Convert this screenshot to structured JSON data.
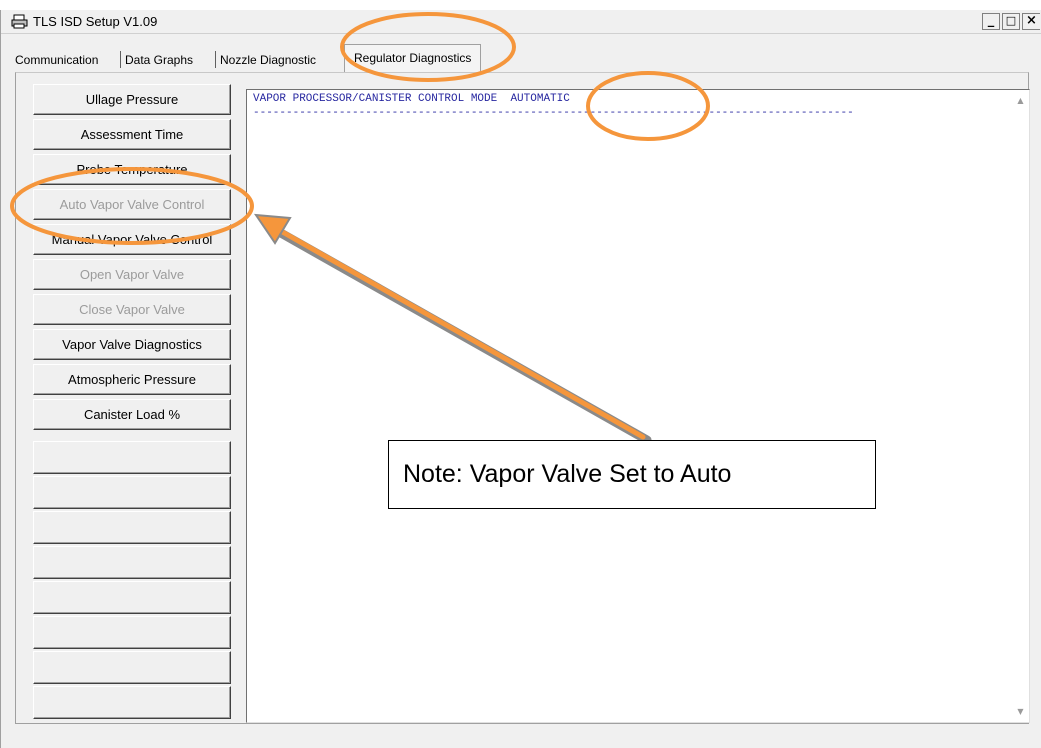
{
  "window": {
    "title": "TLS ISD Setup V1.09",
    "buttons": {
      "minimize": "_",
      "maximize": "□",
      "close": "×"
    }
  },
  "tabs": [
    {
      "label": "Communication",
      "active": false
    },
    {
      "label": "Data Graphs",
      "active": false
    },
    {
      "label": "Nozzle Diagnostic",
      "active": false
    },
    {
      "label": "Regulator Diagnostics",
      "active": true
    }
  ],
  "left_buttons": [
    {
      "label": "Ullage Pressure",
      "enabled": true
    },
    {
      "label": "Assessment Time",
      "enabled": true
    },
    {
      "label": "Probe Temperature",
      "enabled": true
    },
    {
      "label": "Auto Vapor Valve Control",
      "enabled": false
    },
    {
      "label": "Manual Vapor Valve Control",
      "enabled": true
    },
    {
      "label": "Open Vapor Valve",
      "enabled": false
    },
    {
      "label": "Close Vapor Valve",
      "enabled": false
    },
    {
      "label": "Vapor Valve Diagnostics",
      "enabled": true
    },
    {
      "label": "Atmospheric Pressure",
      "enabled": true
    },
    {
      "label": "Canister Load %",
      "enabled": true
    },
    {
      "label": "",
      "enabled": true
    },
    {
      "label": "",
      "enabled": true
    },
    {
      "label": "",
      "enabled": true
    },
    {
      "label": "",
      "enabled": true
    },
    {
      "label": "",
      "enabled": true
    },
    {
      "label": "",
      "enabled": true
    },
    {
      "label": "",
      "enabled": true
    },
    {
      "label": "",
      "enabled": true
    }
  ],
  "output": {
    "mode_label": "VAPOR PROCESSOR/CANISTER CONTROL MODE",
    "mode_value": "AUTOMATIC",
    "separator": "-------------------------------------------------------------------------------------------"
  },
  "annotation": {
    "note": "Note: Vapor Valve Set to Auto",
    "highlight_color": "#f5963c",
    "arrow_color": "#f5963c"
  },
  "colors": {
    "output_text": "#2828a0",
    "disabled_text": "#9b9b9b",
    "window_bg": "#f0f0f0"
  }
}
